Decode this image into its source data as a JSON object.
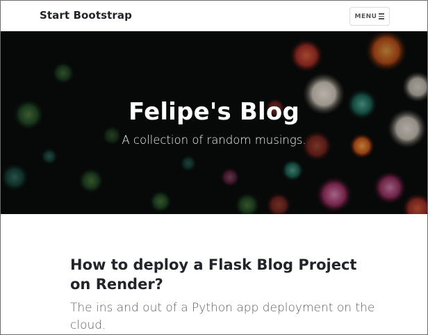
{
  "navbar": {
    "brand": "Start Bootstrap",
    "menu_label": "MENU",
    "menu_icon": "hamburger-icon"
  },
  "masthead": {
    "title": "Felipe's Blog",
    "subtitle": "A collection of random musings.",
    "background": "sea-anemone-photo"
  },
  "post": {
    "title": "How to deploy a Flask Blog Project on Render?",
    "subtitle": "The ins and out of a Python app deployment on the cloud."
  },
  "colors": {
    "text": "#212529",
    "subtitle": "#5a5f63",
    "masthead_bg": "#0b0d0c"
  }
}
